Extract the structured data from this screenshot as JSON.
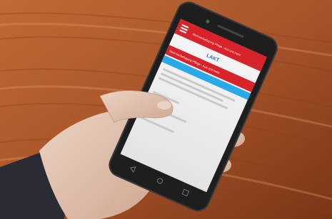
{
  "photo": {
    "subject": "hand holding smartphone showing a mobile web page",
    "colors": {
      "wood": "#b5602f",
      "wood_dark": "#8a3f1a",
      "phone_body": "#1e1e1e",
      "phone_bezel": "#2a2a2a",
      "screen_header": "#d8232a",
      "screen_bar": "#2aa9e8",
      "screen_bg": "#f3f3f3",
      "skin": "#e2c6b6",
      "sleeve": "#2a2c33"
    }
  },
  "phone_screen": {
    "header_title": "Renovierbefugung Pflege - Aus und mehr",
    "section_title": "Renovierbefugung Pflege - Aus und mehr",
    "logo_text": "LAKT"
  }
}
